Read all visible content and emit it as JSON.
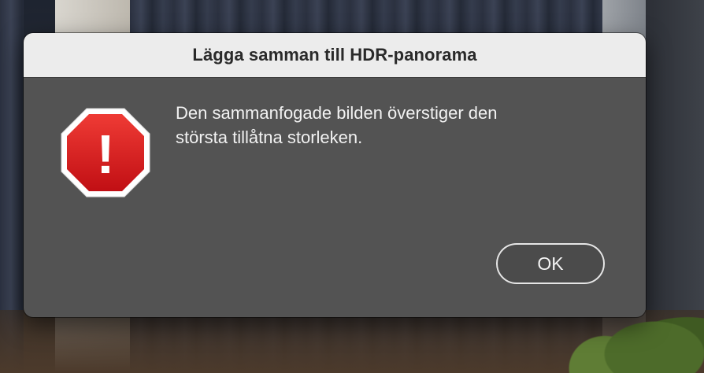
{
  "dialog": {
    "title": "Lägga samman till HDR-panorama",
    "message_lines": [
      "Den sammanfogade bilden överstiger den",
      "största tillåtna storleken."
    ],
    "ok_label": "OK",
    "icon": "stop-sign-icon",
    "icon_symbol": "!",
    "colors": {
      "titlebar": "#ececec",
      "body": "#535353",
      "stop_icon_red": "#d5161b",
      "button_border": "#e6e6e6"
    }
  }
}
